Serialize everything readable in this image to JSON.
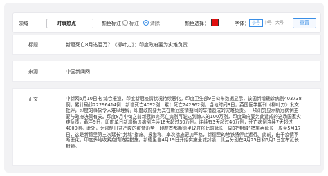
{
  "toolbar": {
    "category_label": "领域",
    "category_value": "时事热点",
    "color_mark_label": "颜色标注：",
    "radio_mark": "标注",
    "radio_clear": "清除",
    "color_pick_label": "颜色选择：",
    "selected_color": "#e01010",
    "font_label": "字体：",
    "font_sizes": [
      "小号",
      "中号",
      "大号"
    ],
    "active_font_size": "小号",
    "reset_label": "重置"
  },
  "fields": {
    "title_key": "标题",
    "title_value": "新冠死亡8月达百万？《柳叶刀》：印度政府要为灾难负责",
    "source_key": "来源",
    "source_value": "中国新闻网",
    "body_key": "正文",
    "body_value": "中新网5月10日电 综合报道，印度新冠疫情状况持续恶化。印度卫生部9日公布数据显示，该国新增确诊病例403738例，累计确诊22296414例；新增死亡4092例，累计死亡242362例。当地时间8日，英国医学期刊《柳叶刀》发文批评，印度的事象令人难以理解，印度政府要为其在新冠疫情期间的举措造成的灾难负责。一项研究显示新冠病例主要与政府决策有关。印度8月中旬之前新冠肺炎死亡病例可能达到惊人的100万例，印度政府要为此造成的这场国家灾难负责。截至9日，印度单日新增确诊病例连续18天超过30万例。连续有3天超过40万例，死亡病例连续7天超过4000例。此外，为遏制日益严峻的疫情形势，印度首都新德里政府将此前延长一周的“封城”措施再延长一周至5月17日，这是新德里第三次延长“封城”措施。报道称，本次措施更加严格，新德里的地铁将停止运行。此前，由于疫情不断恶化，印度多地收紧疫情防控措施。新德里自4月19日开始实施全城封锁，此后分别在4月25日和5月1日宣布延长封锁。"
  }
}
